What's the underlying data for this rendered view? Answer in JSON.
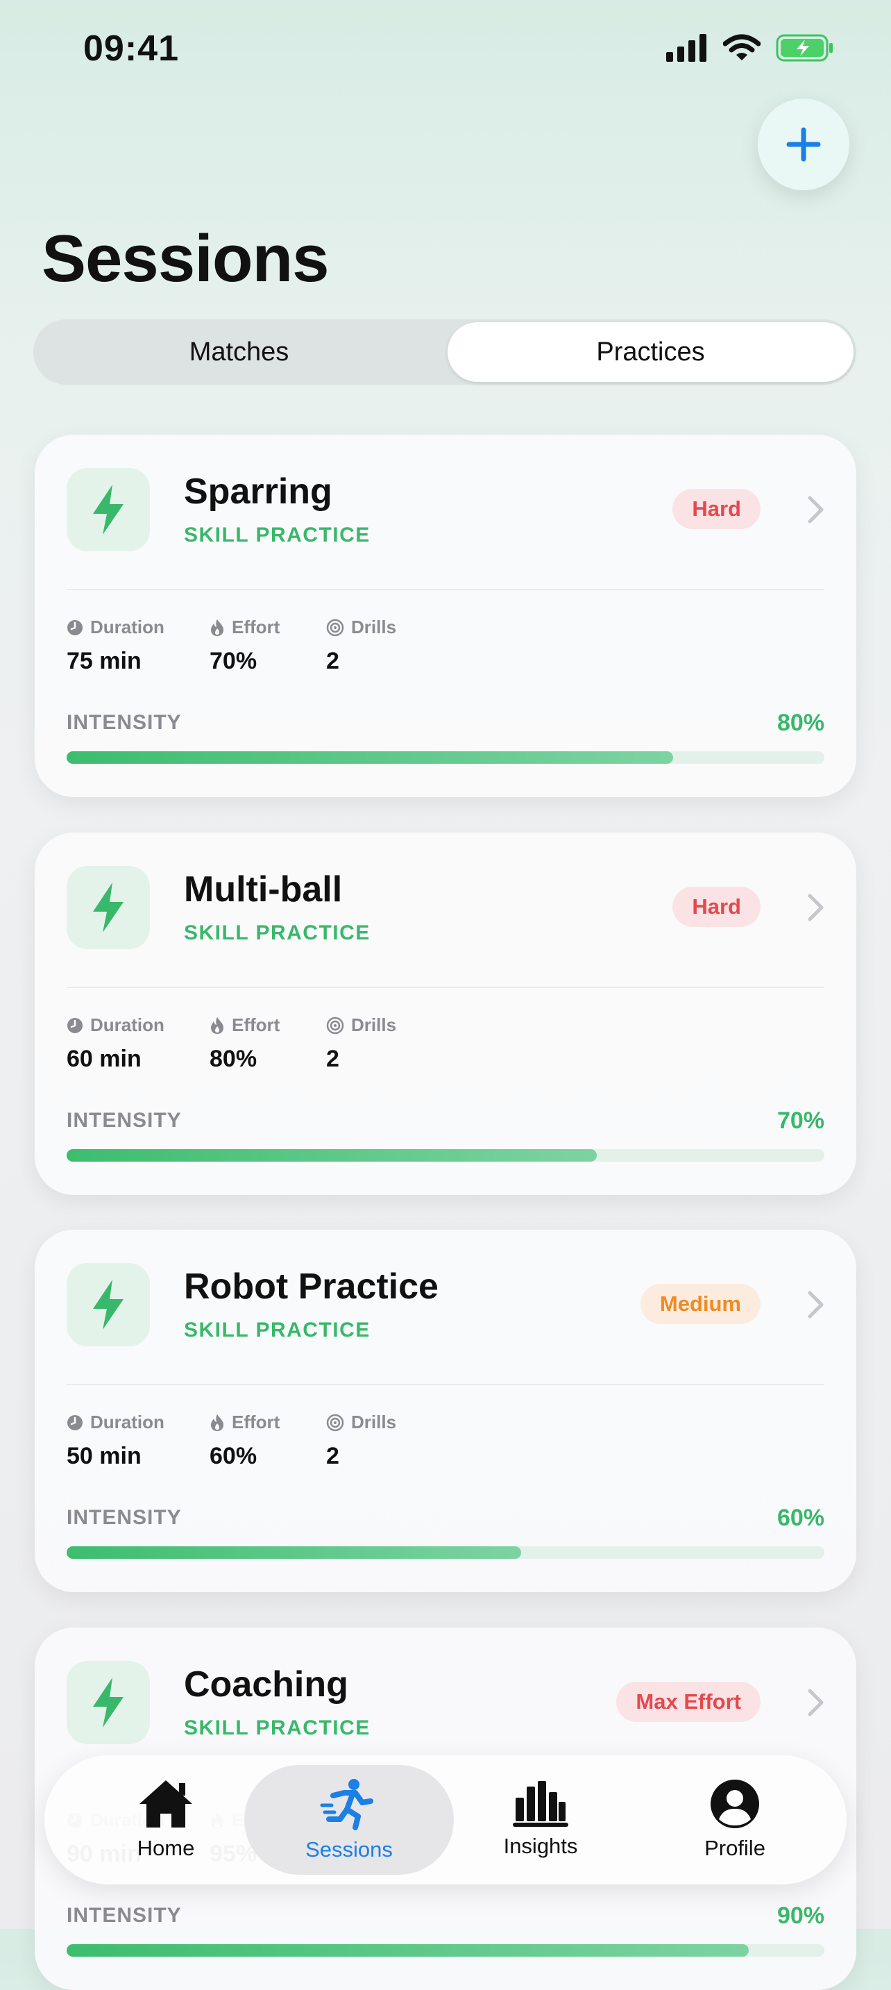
{
  "status_bar": {
    "time": "09:41"
  },
  "header": {
    "title": "Sessions"
  },
  "segments": [
    {
      "label": "Matches",
      "active": false
    },
    {
      "label": "Practices",
      "active": true
    }
  ],
  "stat_labels": {
    "duration": "Duration",
    "effort": "Effort",
    "drills": "Drills"
  },
  "intensity_label": "INTENSITY",
  "colors": {
    "accent_green": "#38b86a",
    "hard_red": "#e5484d",
    "medium_orange": "#f08a24",
    "tab_active_blue": "#1b7fe6"
  },
  "sessions": [
    {
      "name": "Sparring",
      "subtitle": "SKILL PRACTICE",
      "badge": "Hard",
      "badge_level": "hard",
      "duration": "75 min",
      "effort": "70%",
      "drills": "2",
      "intensity_text": "80%",
      "intensity": 0.8
    },
    {
      "name": "Multi-ball",
      "subtitle": "SKILL PRACTICE",
      "badge": "Hard",
      "badge_level": "hard",
      "duration": "60 min",
      "effort": "80%",
      "drills": "2",
      "intensity_text": "70%",
      "intensity": 0.7
    },
    {
      "name": "Robot Practice",
      "subtitle": "SKILL PRACTICE",
      "badge": "Medium",
      "badge_level": "medium",
      "duration": "50 min",
      "effort": "60%",
      "drills": "2",
      "intensity_text": "60%",
      "intensity": 0.6
    },
    {
      "name": "Coaching",
      "subtitle": "SKILL PRACTICE",
      "badge": "Max Effort",
      "badge_level": "hard",
      "duration": "90 min",
      "effort": "95%",
      "drills": "3",
      "intensity_text": "90%",
      "intensity": 0.9
    }
  ],
  "tabbar": [
    {
      "label": "Home",
      "icon": "home-icon",
      "active": false
    },
    {
      "label": "Sessions",
      "icon": "runner-icon",
      "active": true
    },
    {
      "label": "Insights",
      "icon": "bar-chart-icon",
      "active": false
    },
    {
      "label": "Profile",
      "icon": "person-icon",
      "active": false
    }
  ]
}
